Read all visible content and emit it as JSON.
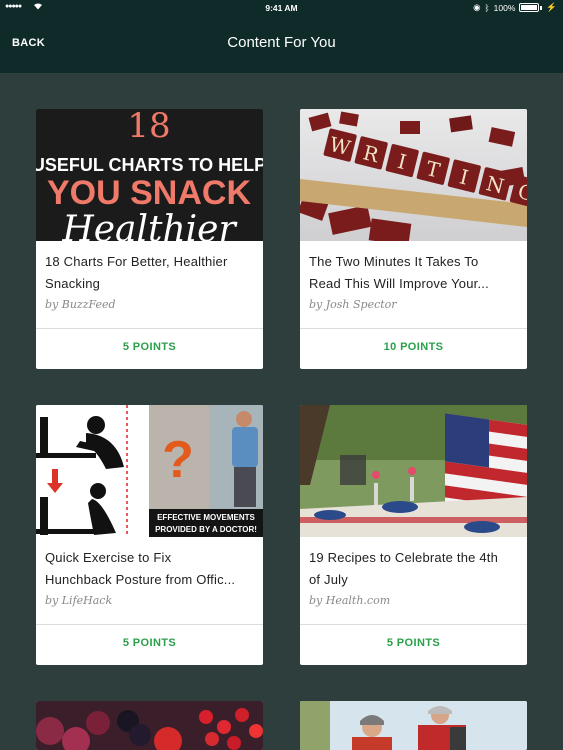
{
  "status_bar": {
    "signal": "●●●●●",
    "time": "9:41 AM",
    "battery": "100%"
  },
  "nav": {
    "back_label": "BACK",
    "title": "Content For You"
  },
  "cards": [
    {
      "title_line1": "18 Charts For Better, Healthier",
      "title_line2": "Snacking",
      "byline": "by BuzzFeed",
      "points": "5 POINTS",
      "thumb_text": {
        "number": "18",
        "line1": "USEFUL CHARTS TO HELP",
        "line2": "YOU SNACK",
        "line3": "Healthier"
      }
    },
    {
      "title_line1": "The Two Minutes It Takes To",
      "title_line2": "Read This Will Improve Your...",
      "byline": "by Josh Spector",
      "points": "10 POINTS",
      "thumb_text": {
        "tiles": [
          "W",
          "R",
          "I",
          "T",
          "I",
          "N",
          "G"
        ]
      }
    },
    {
      "title_line1": "Quick Exercise to Fix",
      "title_line2": "Hunchback Posture from Offic...",
      "byline": "by LifeHack",
      "points": "5 POINTS",
      "thumb_text": {
        "mark": "?",
        "caption1": "EFFECTIVE MOVEMENTS",
        "caption2": "PROVIDED BY A DOCTOR!"
      }
    },
    {
      "title_line1": "19 Recipes to Celebrate the 4th",
      "title_line2": "of July",
      "byline": "by Health.com",
      "points": "5 POINTS"
    }
  ],
  "colors": {
    "nav_bg": "#0f2b29",
    "page_bg": "#2e3e3d",
    "points_green": "#2aa04a"
  }
}
